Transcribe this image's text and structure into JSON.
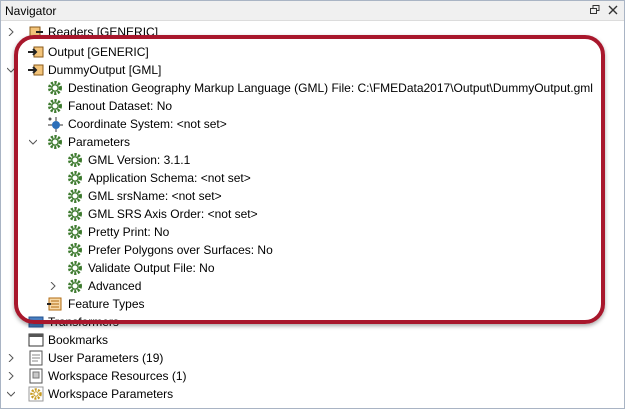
{
  "panel": {
    "title": "Navigator"
  },
  "tree": {
    "readers": "Readers [GENERIC]",
    "output": "Output [GENERIC]",
    "dummy": "DummyOutput [GML]",
    "dest_file": "Destination Geography Markup Language (GML) File: C:\\FMEData2017\\Output\\DummyOutput.gml",
    "fanout": "Fanout Dataset: No",
    "coord": "Coordinate System: <not set>",
    "parameters": "Parameters",
    "params": [
      "GML Version: 3.1.1",
      "Application Schema: <not set>",
      "GML srsName: <not set>",
      "GML SRS Axis Order: <not set>",
      "Pretty Print: No",
      "Prefer Polygons over Surfaces: No",
      "Validate Output File: No",
      "Advanced"
    ],
    "feature_types": "Feature Types",
    "transformers": "Transformers",
    "bookmarks": "Bookmarks",
    "user_params": "User Parameters (19)",
    "resources": "Workspace Resources (1)",
    "ws_params": "Workspace Parameters"
  },
  "colors": {
    "highlight": "#a8172c",
    "gear": "#3d7a2e"
  }
}
